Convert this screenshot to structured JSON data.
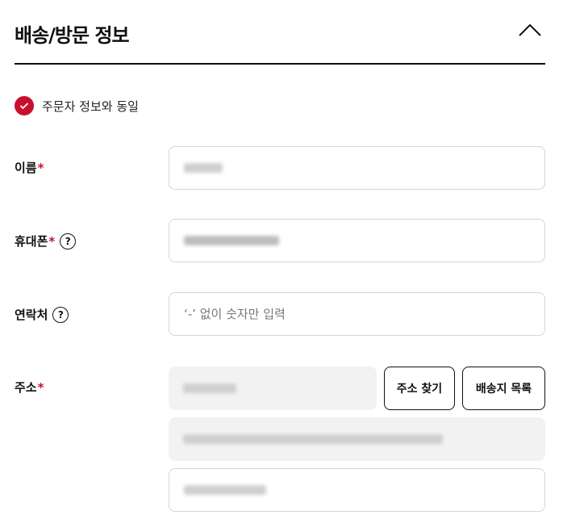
{
  "section": {
    "title": "배송/방문 정보",
    "toggle_icon": "chevron-up-icon"
  },
  "same_as_orderer": {
    "label": "주문자 정보와 동일",
    "checked": true,
    "accent_color": "#c8102e"
  },
  "fields": {
    "name": {
      "label": "이름",
      "required_mark": "*"
    },
    "mobile": {
      "label": "휴대폰",
      "required_mark": "*",
      "help_icon_text": "?"
    },
    "contact": {
      "label": "연락처",
      "help_icon_text": "?",
      "placeholder": "‘-’ 없이 숫자만 입력"
    },
    "address": {
      "label": "주소",
      "required_mark": "*",
      "search_button": "주소 찾기",
      "list_button": "배송지 목록"
    }
  }
}
